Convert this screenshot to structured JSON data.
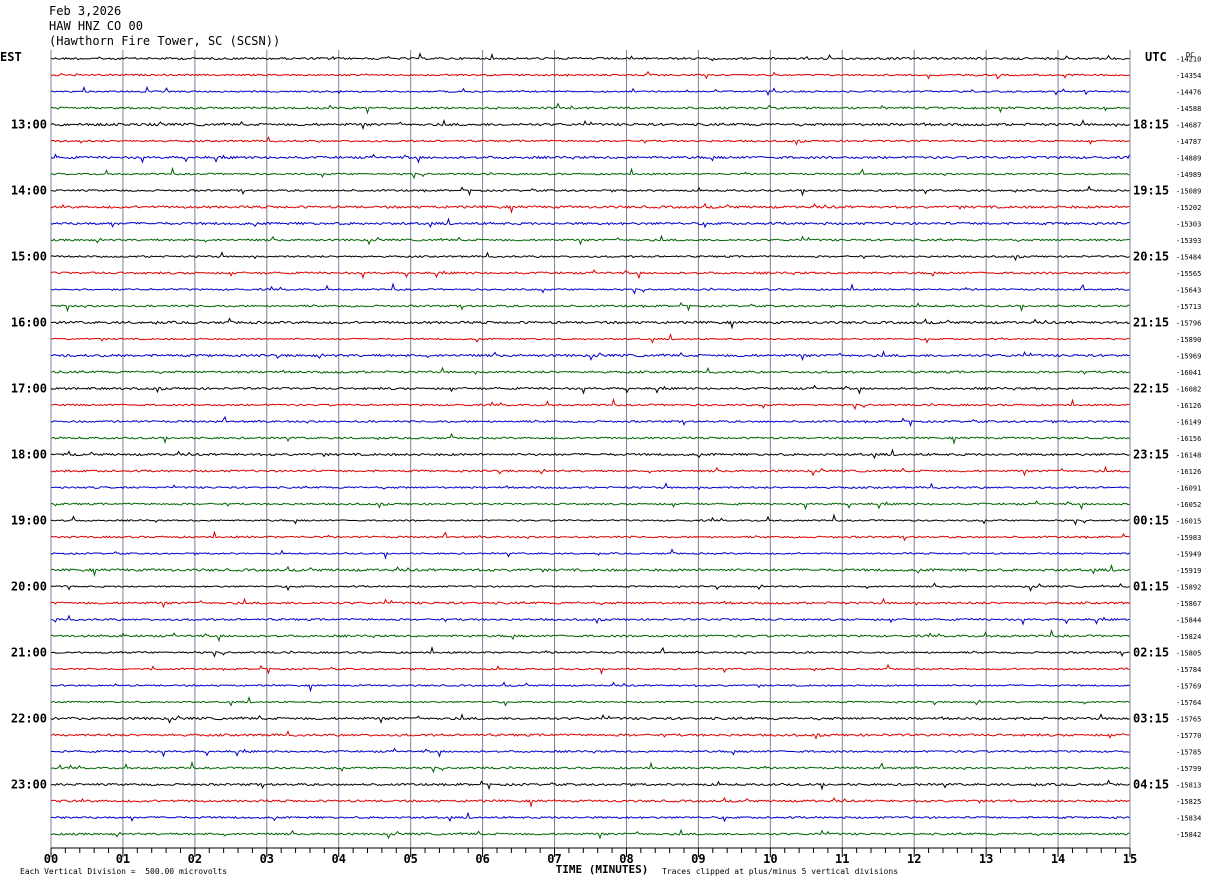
{
  "header": {
    "date": "Feb 3,2026",
    "channel": "HAW HNZ CO 00",
    "station": "(Hawthorn Fire Tower, SC (SCSN))"
  },
  "left_tz": "EST",
  "right_tz": "UTC",
  "dc_label": "DC",
  "footer": {
    "scale_note": "Each Vertical Division =  500.00 microvolts",
    "clip_note": "Traces clipped at plus/minus 5 vertical divisions"
  },
  "colors": {
    "trace_cycle": [
      "#000000",
      "#e00000",
      "#0000cc",
      "#006400"
    ],
    "grid": "#7f7f9f"
  },
  "chart_data": {
    "type": "line",
    "title": "",
    "xlabel": "TIME (MINUTES)",
    "ylabel": "",
    "xlim": [
      0,
      15
    ],
    "x_ticks": [
      "00",
      "01",
      "02",
      "03",
      "04",
      "05",
      "06",
      "07",
      "08",
      "09",
      "10",
      "11",
      "12",
      "13",
      "14",
      "15"
    ],
    "traces_per_hour": 4,
    "left_hour_labels": [
      "13:00",
      "14:00",
      "15:00",
      "16:00",
      "17:00",
      "18:00",
      "19:00",
      "20:00",
      "21:00",
      "22:00",
      "23:00"
    ],
    "right_hour_labels": [
      "18:15",
      "19:15",
      "20:15",
      "21:15",
      "22:15",
      "23:15",
      "00:15",
      "01:15",
      "02:15",
      "03:15",
      "04:15"
    ],
    "hour_label_trace_index": 4,
    "dc_offsets": [
      -14210,
      -14354,
      -14476,
      -14588,
      -14687,
      -14787,
      -14889,
      -14989,
      -15089,
      -15202,
      -15303,
      -15393,
      -15484,
      -15565,
      -15643,
      -15713,
      -15796,
      -15890,
      -15969,
      -16041,
      -16082,
      -16126,
      -16149,
      -16156,
      -16148,
      -16126,
      -16091,
      -16052,
      -16015,
      -15983,
      -15949,
      -15919,
      -15892,
      -15867,
      -15844,
      -15824,
      -15805,
      -15784,
      -15769,
      -15764,
      -15765,
      -15770,
      -15785,
      -15799,
      -15813,
      -15825,
      -15834,
      -15842
    ]
  }
}
